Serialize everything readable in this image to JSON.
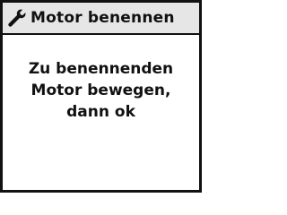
{
  "title_bar": {
    "icon": "wrench-icon",
    "title": "Motor benennen"
  },
  "message": {
    "lines": [
      "Zu benennenden",
      "Motor bewegen,",
      "dann ok"
    ]
  }
}
